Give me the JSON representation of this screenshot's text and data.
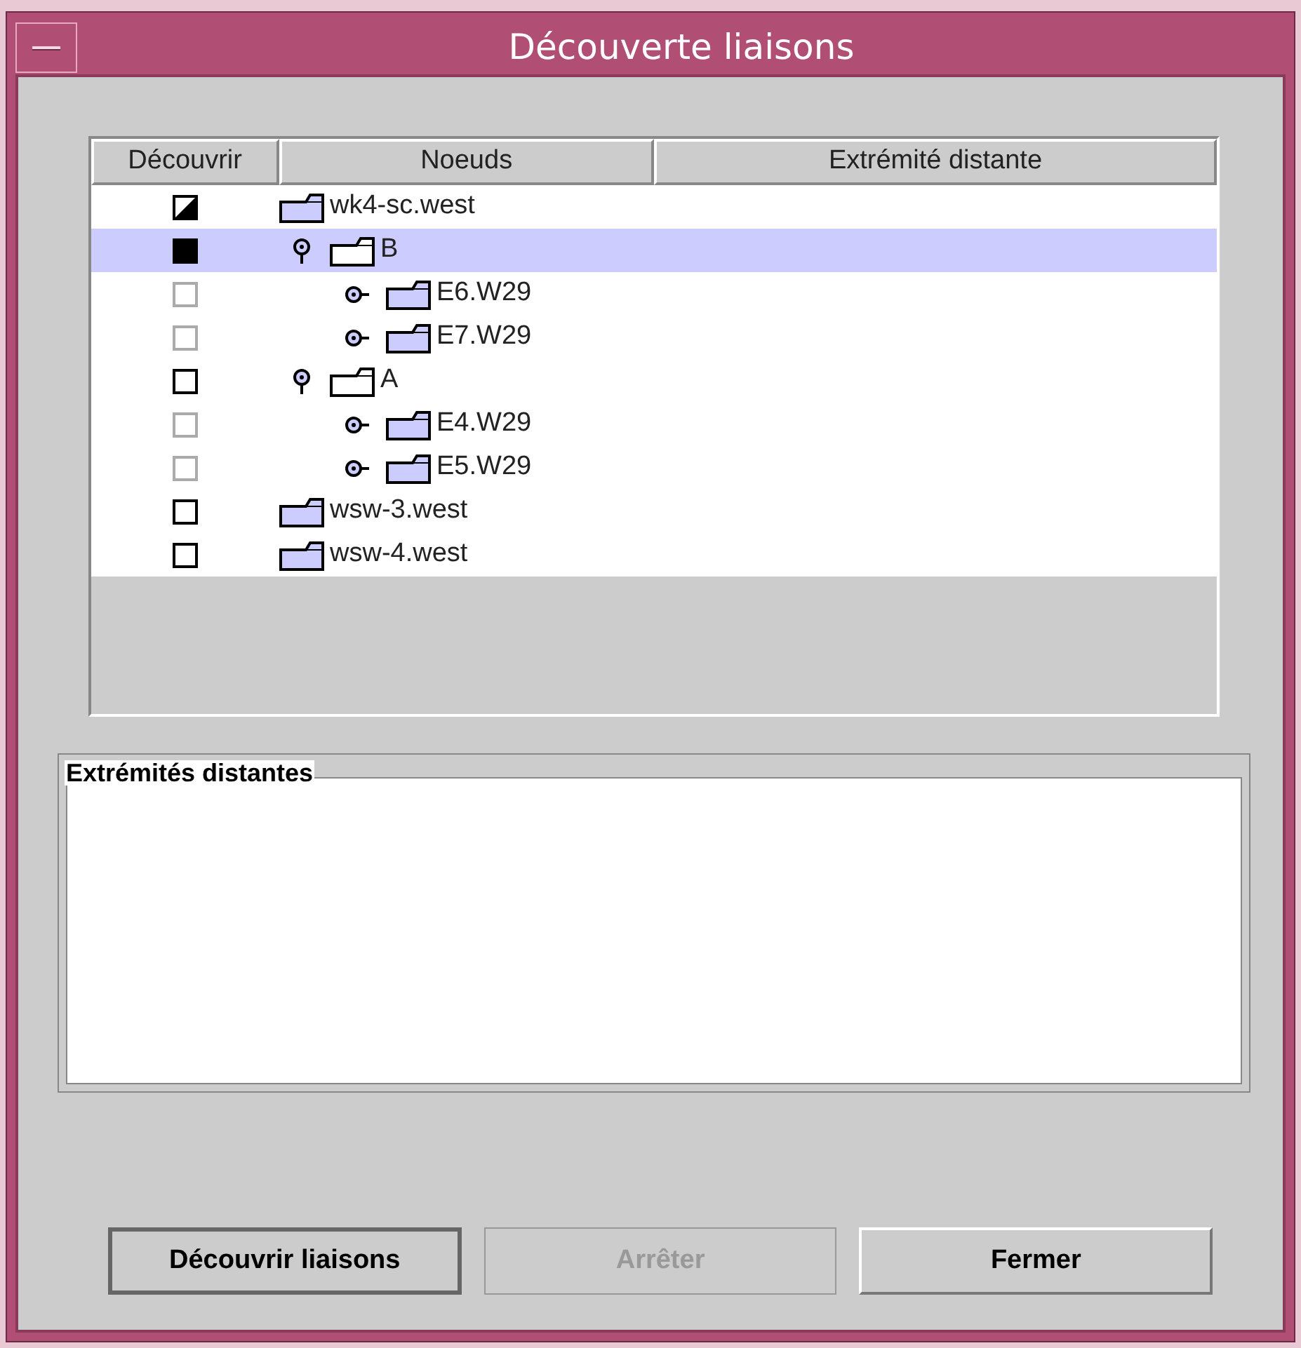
{
  "window": {
    "title": "Découverte liaisons"
  },
  "table": {
    "columns": [
      "Découvrir",
      "Noeuds",
      "Extrémité distante"
    ],
    "rows": [
      {
        "checked": true,
        "mixed": true,
        "disabled": false,
        "selected": false,
        "label": "wk4-sc.west",
        "children": [
          {
            "checked": true,
            "mixed": false,
            "disabled": false,
            "selected": true,
            "label": "B",
            "expanded": true,
            "children": [
              {
                "checked": false,
                "mixed": false,
                "disabled": true,
                "selected": false,
                "label": "E6.W29",
                "expanded": false
              },
              {
                "checked": false,
                "mixed": false,
                "disabled": true,
                "selected": false,
                "label": "E7.W29",
                "expanded": false
              }
            ]
          },
          {
            "checked": false,
            "mixed": false,
            "disabled": false,
            "selected": false,
            "label": "A",
            "expanded": true,
            "children": [
              {
                "checked": false,
                "mixed": false,
                "disabled": true,
                "selected": false,
                "label": "E4.W29",
                "expanded": false
              },
              {
                "checked": false,
                "mixed": false,
                "disabled": true,
                "selected": false,
                "label": "E5.W29",
                "expanded": false
              }
            ]
          }
        ]
      },
      {
        "checked": false,
        "mixed": false,
        "disabled": false,
        "selected": false,
        "label": "wsw-3.west"
      },
      {
        "checked": false,
        "mixed": false,
        "disabled": false,
        "selected": false,
        "label": "wsw-4.west"
      }
    ]
  },
  "group": {
    "title": "Extrémités distantes"
  },
  "buttons": [
    {
      "label": "Découvrir liaisons",
      "disabled": false,
      "default": true
    },
    {
      "label": "Arrêter",
      "disabled": true,
      "default": false
    },
    {
      "label": "Fermer",
      "disabled": false,
      "default": false
    }
  ]
}
